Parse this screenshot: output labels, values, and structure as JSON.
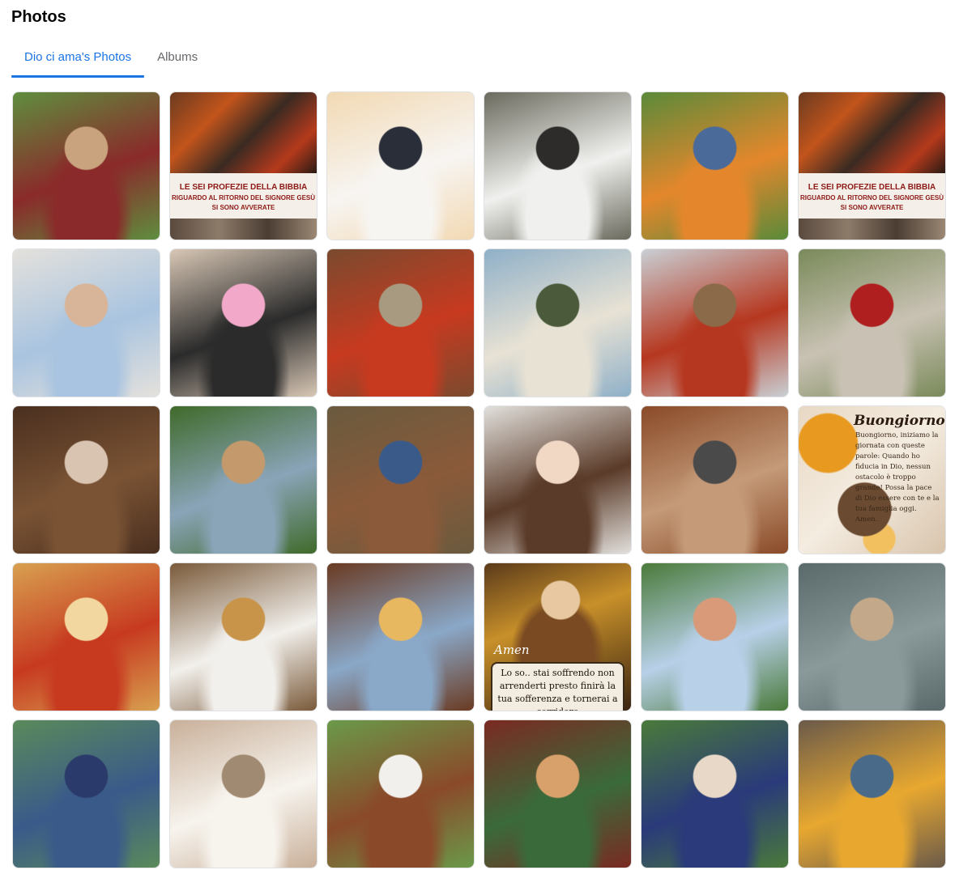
{
  "header": {
    "title": "Photos"
  },
  "tabs": [
    {
      "label": "Dio ci ama's Photos",
      "active": true
    },
    {
      "label": "Albums",
      "active": false
    }
  ],
  "accent_color": "#1b74e4",
  "photos": [
    {
      "kind": "photo",
      "subject": "boy selfie on football pitch",
      "colors": [
        "#5f8e3f",
        "#8a2a2a",
        "#c9a27e"
      ]
    },
    {
      "kind": "poster",
      "line1": "LE SEI PROFEZIE DELLA BIBBIA",
      "line2": "RIGUARDO AL RITORNO DEL SIGNORE GESÙ",
      "line3": "SI SONO AVVERATE"
    },
    {
      "kind": "photo",
      "subject": "naval officer wedding",
      "colors": [
        "#f2d9b3",
        "#f7f5f2",
        "#2a2e38"
      ]
    },
    {
      "kind": "photo",
      "subject": "woman with cows and bucket",
      "colors": [
        "#6a6a5e",
        "#f0f0ee",
        "#2d2c2a"
      ]
    },
    {
      "kind": "photo",
      "subject": "family with carrots and dog",
      "colors": [
        "#5a8a3a",
        "#e4872c",
        "#4a6a9a"
      ]
    },
    {
      "kind": "poster",
      "line1": "LE SEI PROFEZIE DELLA BIBBIA",
      "line2": "RIGUARDO AL RITORNO DEL SIGNORE GESÙ",
      "line3": "SI SONO AVVERATE"
    },
    {
      "kind": "photo",
      "subject": "woman with doll",
      "colors": [
        "#e4e1dc",
        "#a9c4e0",
        "#d8b499"
      ]
    },
    {
      "kind": "photo",
      "subject": "husky with 16 cake",
      "colors": [
        "#d8c7b5",
        "#2b2b2b",
        "#f2a8c8"
      ]
    },
    {
      "kind": "photo",
      "subject": "old man with vegetables",
      "colors": [
        "#7a4a2e",
        "#c73a20",
        "#a89a80"
      ]
    },
    {
      "kind": "photo",
      "subject": "shepherd with sheep",
      "colors": [
        "#8fb0c8",
        "#e8e2d4",
        "#4a5a3a"
      ]
    },
    {
      "kind": "photo",
      "subject": "woman selfie with tractor",
      "colors": [
        "#c9cfd4",
        "#b6371f",
        "#8a6a48"
      ]
    },
    {
      "kind": "photo",
      "subject": "elderly couple with roses",
      "colors": [
        "#7a8a5a",
        "#c9c2b4",
        "#b01f1f"
      ]
    },
    {
      "kind": "photo",
      "subject": "girl in rustic kitchen",
      "colors": [
        "#4a2f1f",
        "#7a5334",
        "#d8c4b0"
      ]
    },
    {
      "kind": "photo",
      "subject": "farmer in garden",
      "colors": [
        "#3f6a2a",
        "#8aa4b8",
        "#c49a6c"
      ]
    },
    {
      "kind": "photo",
      "subject": "boy with cows",
      "colors": [
        "#6a5a3e",
        "#8a5a3a",
        "#3a5a8a"
      ]
    },
    {
      "kind": "photo",
      "subject": "mother with newborn",
      "colors": [
        "#e2e0dc",
        "#5a3a28",
        "#f0d8c4"
      ]
    },
    {
      "kind": "photo",
      "subject": "woman with cattle",
      "colors": [
        "#8a4a28",
        "#c49a78",
        "#4a4a4a"
      ]
    },
    {
      "kind": "buongiorno",
      "title": "Buongiorno",
      "text": "Buongiorno, iniziamo la giornata con queste parole: Quando ho fiducia in Dio, nessun ostacolo è troppo grande! Possa la pace di Dio essere con te e la tua famiglia oggi. Amen."
    },
    {
      "kind": "photo",
      "subject": "baby in hot dog costume",
      "colors": [
        "#d8a050",
        "#c73a20",
        "#f2d8a0"
      ]
    },
    {
      "kind": "photo",
      "subject": "baker with bread pug",
      "colors": [
        "#7a5a3a",
        "#f2f0ec",
        "#c8944a"
      ]
    },
    {
      "kind": "photo",
      "subject": "grandmother with pastries",
      "colors": [
        "#6a3a22",
        "#8aa8c8",
        "#e8b860"
      ]
    },
    {
      "kind": "padrepio",
      "amen": "Amen",
      "text": "Lo so.. stai soffrendo non arrenderti presto finirà la tua sofferenza e tornerai a sorridere"
    },
    {
      "kind": "photo",
      "subject": "family in garden",
      "colors": [
        "#4a7a3a",
        "#b8d0e8",
        "#d89a78"
      ]
    },
    {
      "kind": "photo",
      "subject": "boy with toy boat",
      "colors": [
        "#5a6a6a",
        "#8a9a9a",
        "#c4a88a"
      ]
    },
    {
      "kind": "photo",
      "subject": "farmers with blueberries",
      "colors": [
        "#5a8a5a",
        "#3a5a8a",
        "#2a3a6a"
      ]
    },
    {
      "kind": "photo",
      "subject": "two fluffy puppies",
      "colors": [
        "#c9b09a",
        "#f7f4ee",
        "#a08a72"
      ]
    },
    {
      "kind": "photo",
      "subject": "woman hugging cow",
      "colors": [
        "#6a9a4a",
        "#8a4a2a",
        "#f2f0ec"
      ]
    },
    {
      "kind": "photo",
      "subject": "boy with pastries",
      "colors": [
        "#7a2a22",
        "#3a6a3a",
        "#d8a06a"
      ]
    },
    {
      "kind": "photo",
      "subject": "girl with blueberry baskets",
      "colors": [
        "#4a7a3a",
        "#2a3a7a",
        "#e8d8c8"
      ]
    },
    {
      "kind": "photo",
      "subject": "workers with corn",
      "colors": [
        "#6a5a4a",
        "#e8a830",
        "#4a6a8a"
      ]
    }
  ]
}
